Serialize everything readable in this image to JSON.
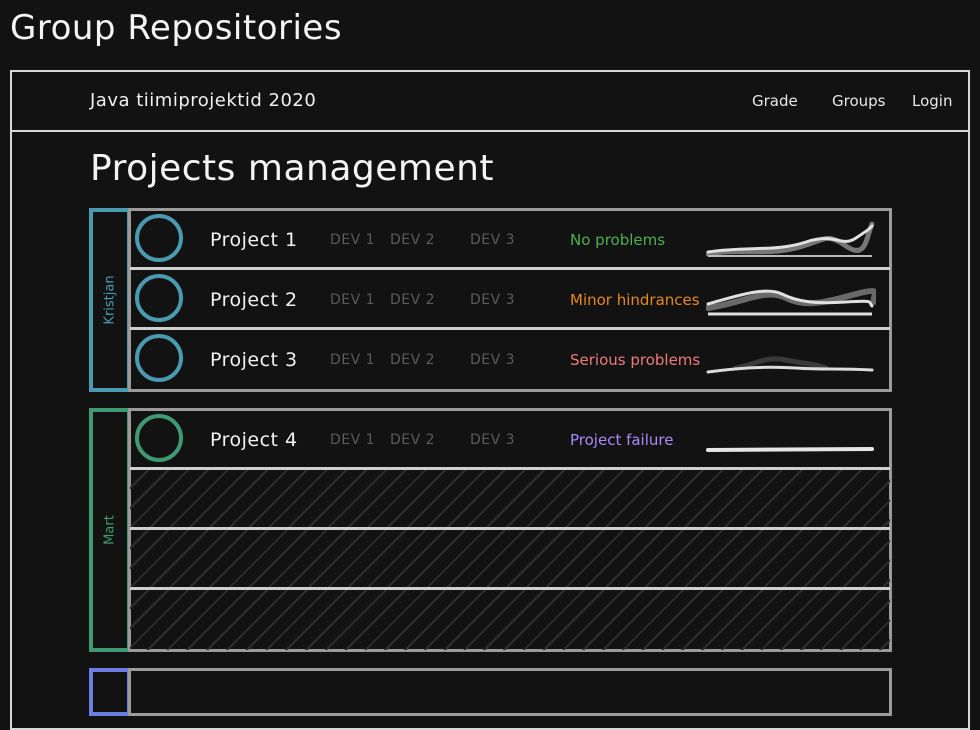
{
  "page": {
    "title": "Group Repositories"
  },
  "navbar": {
    "brand": "Java tiimiprojektid  2020",
    "links": [
      "Grade",
      "Groups",
      "Login"
    ]
  },
  "main": {
    "title": "Projects management"
  },
  "groups": [
    {
      "name": "Kristjan",
      "color": "#4a9bb0",
      "projects": [
        {
          "name": "Project 1",
          "devs": [
            "DEV 1",
            "DEV 2",
            "DEV 3"
          ],
          "status": "No problems",
          "status_color": "#4caf50"
        },
        {
          "name": "Project 2",
          "devs": [
            "DEV 1",
            "DEV 2",
            "DEV 3"
          ],
          "status": "Minor hindrances",
          "status_color": "#e8891c"
        },
        {
          "name": "Project 3",
          "devs": [
            "DEV 1",
            "DEV 2",
            "DEV 3"
          ],
          "status": "Serious problems",
          "status_color": "#f07a7a"
        }
      ]
    },
    {
      "name": "Mart",
      "color": "#3f9a73",
      "projects": [
        {
          "name": "Project 4",
          "devs": [
            "DEV 1",
            "DEV 2",
            "DEV 3"
          ],
          "status": "Project failure",
          "status_color": "#a78bfa"
        }
      ]
    },
    {
      "name": "",
      "color": "#6b7fe0",
      "projects": []
    }
  ]
}
